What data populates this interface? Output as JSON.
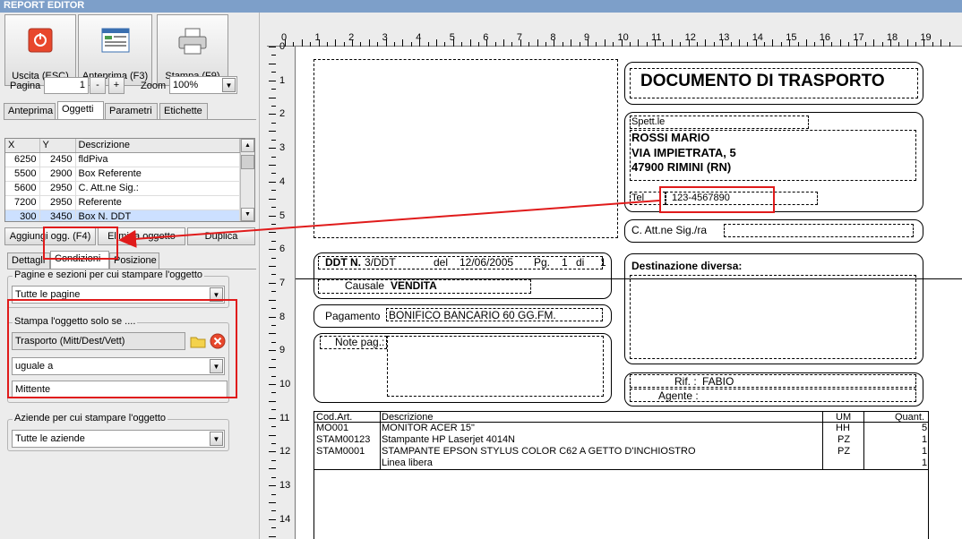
{
  "window": {
    "title": "REPORT EDITOR"
  },
  "toolbar": {
    "exit_label": "Uscita (ESC)",
    "preview_label": "Anteprima (F3)",
    "print_label": "Stampa (F9)"
  },
  "pager": {
    "page_label": "Pagina",
    "page_value": "1",
    "minus": "-",
    "plus": "+",
    "zoom_label": "Zoom",
    "zoom_value": "100%"
  },
  "tabs_top": [
    "Anteprima",
    "Oggetti",
    "Parametri",
    "Etichette"
  ],
  "objects_table": {
    "headers": [
      "X",
      "Y",
      "Descrizione"
    ],
    "rows": [
      {
        "x": "6250",
        "y": "2450",
        "desc": "fldPiva"
      },
      {
        "x": "5500",
        "y": "2900",
        "desc": "Box Referente"
      },
      {
        "x": "5600",
        "y": "2950",
        "desc": "C. Att.ne Sig.:"
      },
      {
        "x": "7200",
        "y": "2950",
        "desc": "Referente"
      },
      {
        "x": "300",
        "y": "3450",
        "desc": "Box N. DDT"
      }
    ]
  },
  "actions": {
    "add": "Aggiungi ogg. (F4)",
    "remove": "Elimina oggetto",
    "duplicate": "Duplica"
  },
  "tabs_detail": [
    "Dettagli",
    "Condizioni",
    "Posizione"
  ],
  "conditions": {
    "pages_group": "Pagine e sezioni per cui stampare l'oggetto",
    "pages_value": "Tutte le pagine",
    "print_if_group": "Stampa l'oggetto solo se ....",
    "field_value": "Trasporto (Mitt/Dest/Vett)",
    "operator_value": "uguale a",
    "compare_value": "Mittente",
    "companies_group": "Aziende per cui stampare l'oggetto",
    "companies_value": "Tutte le aziende"
  },
  "ruler": {
    "top": [
      "0",
      "1",
      "2",
      "3",
      "4",
      "5",
      "6",
      "7",
      "8",
      "9",
      "10",
      "11",
      "12",
      "13",
      "14",
      "15",
      "16",
      "17",
      "18",
      "19"
    ],
    "left": [
      "0",
      "1",
      "2",
      "3",
      "4",
      "5",
      "6",
      "7",
      "8",
      "9",
      "10",
      "11",
      "12",
      "13",
      "14"
    ]
  },
  "document": {
    "title": "DOCUMENTO DI TRASPORTO",
    "spett_label": "Spett.le",
    "name": "ROSSI MARIO",
    "street": "VIA IMPIETRATA, 5",
    "city": "47900 RIMINI (RN)",
    "tel_label": "Tel",
    "tel_value": "123-4567890",
    "att_label": "C. Att.ne Sig./ra",
    "ddt_label": "DDT N.",
    "ddt_value": "3/DDT",
    "date_label": "del",
    "date_value": "12/06/2005",
    "page_label": "Pg.",
    "page_value": "1",
    "of_label": "di",
    "of_value": "1",
    "causale_label": "Causale",
    "causale_value": "VENDITA",
    "dest_label": "Destinazione diversa:",
    "pay_label": "Pagamento",
    "pay_value": "BONIFICO BANCARIO 60 GG.FM.",
    "notes_label": "Note pag.:",
    "rif_label": "Rif. :",
    "rif_value": "FABIO",
    "agent_label": "Agente :",
    "items_headers": [
      "Cod.Art.",
      "Descrizione",
      "UM",
      "Quant."
    ],
    "items": [
      {
        "code": "MO001",
        "desc": "MONITOR ACER 15\"",
        "um": "HH",
        "qty": "5"
      },
      {
        "code": "STAM00123",
        "desc": "Stampante HP Laserjet 4014N",
        "um": "PZ",
        "qty": "1"
      },
      {
        "code": "STAM0001",
        "desc": "STAMPANTE EPSON STYLUS COLOR C62 A GETTO D'INCHIOSTRO",
        "um": "PZ",
        "qty": "1"
      },
      {
        "code": "",
        "desc": "Linea libera",
        "um": "",
        "qty": "1"
      }
    ]
  },
  "colors": {
    "highlight": "#e01b1b",
    "titlebar": "#7d9fc9"
  }
}
